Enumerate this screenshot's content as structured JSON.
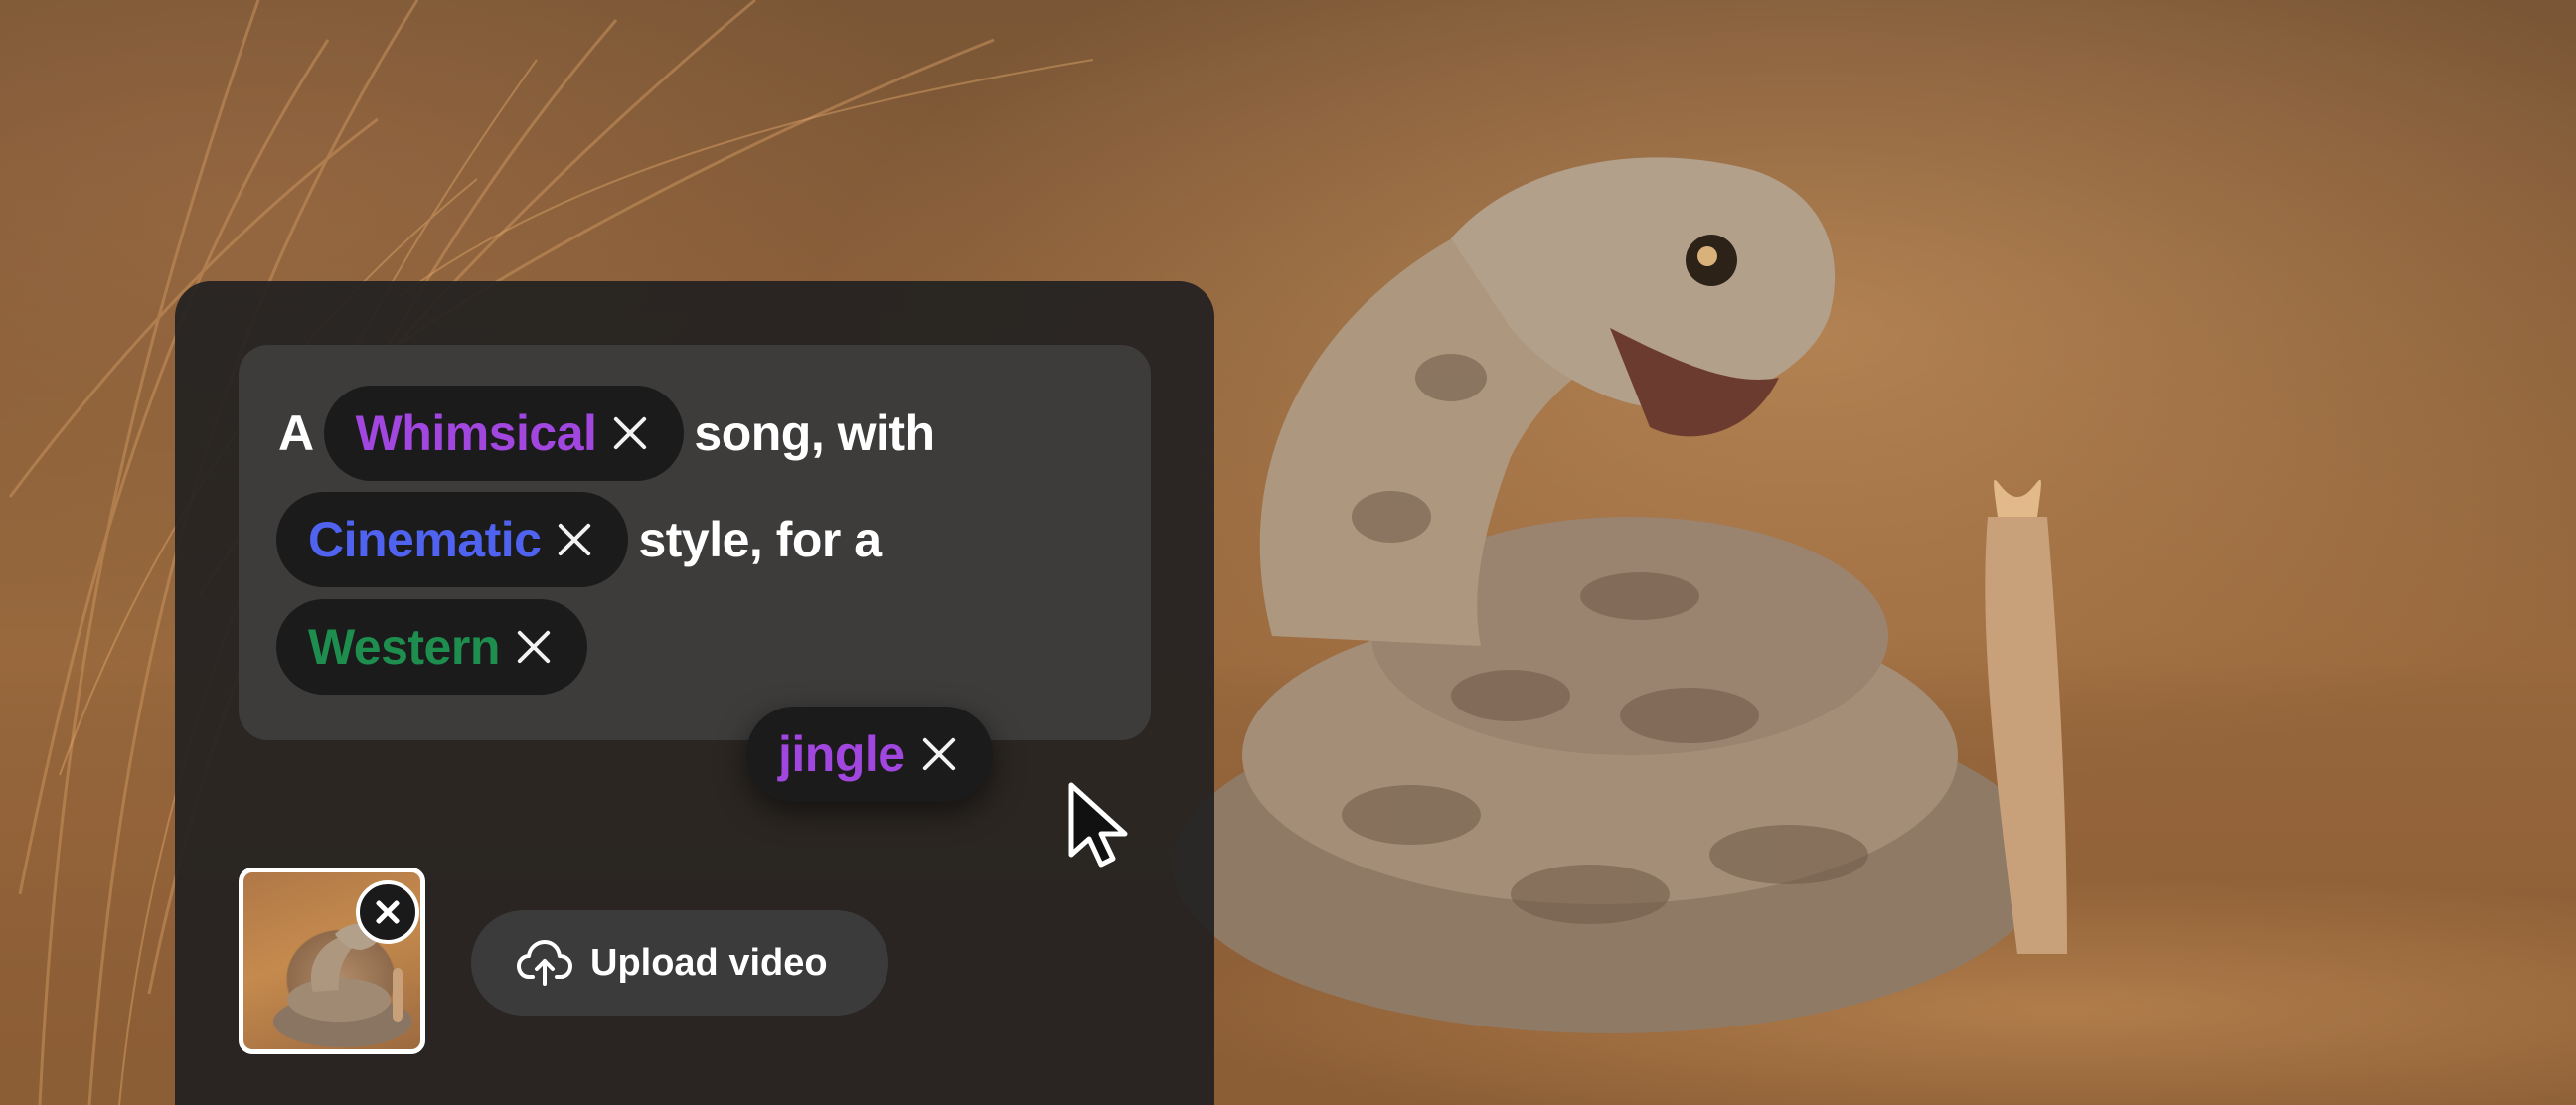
{
  "colors": {
    "panel_bg": "#222121",
    "prompt_bg": "#3e3d3d",
    "chip_bg": "#1b1b1b",
    "whimsical": "#a246e0",
    "cinematic": "#4f63f0",
    "western": "#1e8e4e",
    "jingle": "#a246e0"
  },
  "prompt": {
    "word_a": "A",
    "chip_whimsical": "Whimsical",
    "text_song_with": "song, with",
    "chip_cinematic": "Cinematic",
    "text_style_for_a": "style, for a",
    "chip_western": "Western",
    "chip_jingle": "jingle"
  },
  "media": {
    "upload_label": "Upload video",
    "upload_icon": "cloud-upload-icon",
    "thumbnail_close_icon": "close-icon"
  },
  "cursor_icon": "mouse-pointer-icon"
}
